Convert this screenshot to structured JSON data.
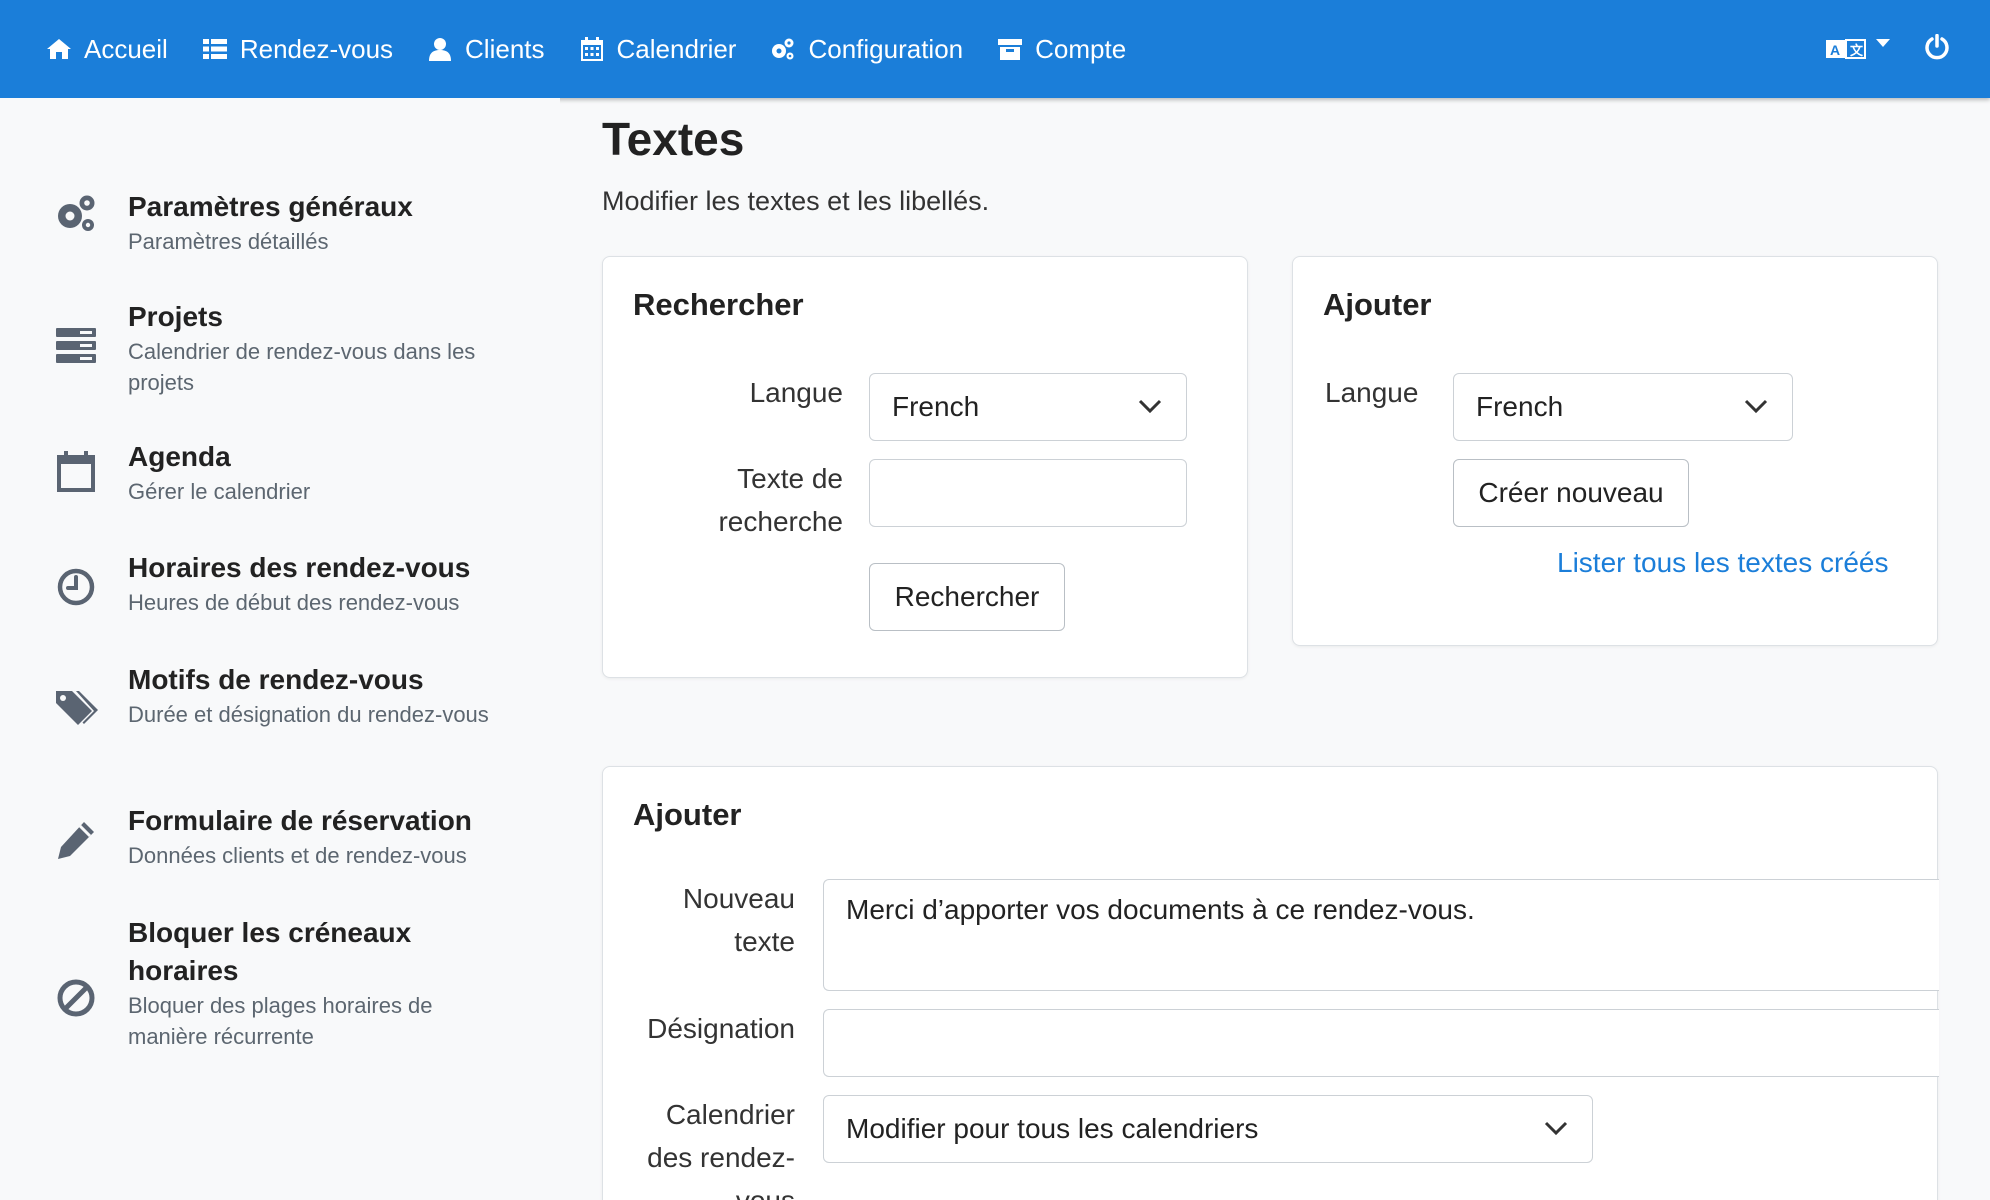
{
  "nav": {
    "items": [
      {
        "label": "Accueil",
        "icon": "home-icon"
      },
      {
        "label": "Rendez-vous",
        "icon": "list-icon"
      },
      {
        "label": "Clients",
        "icon": "user-icon"
      },
      {
        "label": "Calendrier",
        "icon": "calendar-icon"
      },
      {
        "label": "Configuration",
        "icon": "gears-icon"
      },
      {
        "label": "Compte",
        "icon": "archive-icon"
      }
    ],
    "right_icons": [
      "translate-icon",
      "power-icon"
    ]
  },
  "sidebar": {
    "items": [
      {
        "title": "Paramètres généraux",
        "subtitle": "Paramètres détaillés",
        "icon": "gears-icon"
      },
      {
        "title": "Projets",
        "subtitle": "Calendrier de rendez-vous dans les projets",
        "icon": "server-icon"
      },
      {
        "title": "Agenda",
        "subtitle": "Gérer le calendrier",
        "icon": "calendar-icon"
      },
      {
        "title": "Horaires des rendez-vous",
        "subtitle": "Heures de début des rendez-vous",
        "icon": "clock-icon"
      },
      {
        "title": "Motifs de rendez-vous",
        "subtitle": "Durée et désignation du rendez-vous",
        "icon": "tags-icon"
      },
      {
        "title": "Formulaire de réservation",
        "subtitle": "Données clients et de rendez-vous",
        "icon": "pencil-icon"
      },
      {
        "title": "Bloquer les créneaux horaires",
        "subtitle": "Bloquer des plages horaires de manière récurrente",
        "icon": "ban-icon"
      }
    ]
  },
  "main": {
    "title": "Textes",
    "subtitle": "Modifier les textes et les libellés.",
    "search_card": {
      "title": "Rechercher",
      "language_label": "Langue",
      "language_value": "French",
      "search_text_label": "Texte de recherche",
      "search_text_value": "",
      "search_button": "Rechercher"
    },
    "add_card": {
      "title": "Ajouter",
      "language_label": "Langue",
      "language_value": "French",
      "create_button": "Créer nouveau",
      "list_link": "Lister tous les textes créés"
    },
    "edit_card": {
      "title": "Ajouter",
      "new_text_label": "Nouveau texte",
      "new_text_value": "Merci d’apporter vos documents à ce rendez-vous.",
      "designation_label": "Désignation",
      "designation_value": "",
      "calendar_label": "Calendrier des rendez-vous",
      "calendar_value": "Modifier pour tous les calendriers"
    }
  }
}
